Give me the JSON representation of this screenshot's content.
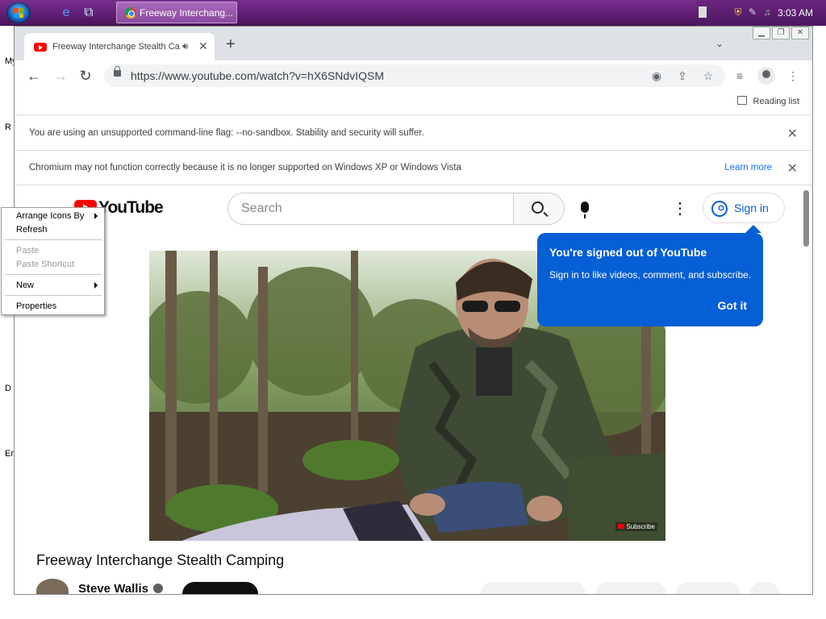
{
  "taskbar": {
    "task_title": "Freeway Interchang...",
    "clock": "3:03 AM"
  },
  "desktop": {
    "letters": [
      "My",
      "R",
      "D",
      "Er"
    ]
  },
  "browser": {
    "tab_title": "Freeway Interchange Stealth Ca",
    "url": "https://www.youtube.com/watch?v=hX6SNdvIQSM",
    "reading_list": "Reading list",
    "infobars": [
      {
        "text": "You are using an unsupported command-line flag: --no-sandbox. Stability and security will suffer."
      },
      {
        "text": "Chromium may not function correctly because it is no longer supported on Windows XP or Windows Vista",
        "link": "Learn more"
      }
    ]
  },
  "youtube": {
    "logo_text": "YouTube",
    "search_placeholder": "Search",
    "signin_label": "Sign in",
    "tooltip": {
      "title": "You're signed out of YouTube",
      "body": "Sign in to like videos, comment, and subscribe.",
      "button": "Got it"
    },
    "video_watermark": "Subscribe",
    "video_title": "Freeway Interchange Stealth Camping",
    "channel_name": "Steve Wallis"
  },
  "context_menu": {
    "items": [
      {
        "label": "Arrange Icons By",
        "submenu": true,
        "enabled": true
      },
      {
        "label": "Refresh",
        "submenu": false,
        "enabled": true
      },
      {
        "label": "Paste",
        "submenu": false,
        "enabled": false
      },
      {
        "label": "Paste Shortcut",
        "submenu": false,
        "enabled": false
      },
      {
        "label": "New",
        "submenu": true,
        "enabled": true
      },
      {
        "label": "Properties",
        "submenu": false,
        "enabled": true
      }
    ]
  },
  "colors": {
    "taskbar": "#5e1d72",
    "youtube_red": "#ff0000",
    "youtube_blue": "#065fd4",
    "link_blue": "#1a73e8"
  }
}
